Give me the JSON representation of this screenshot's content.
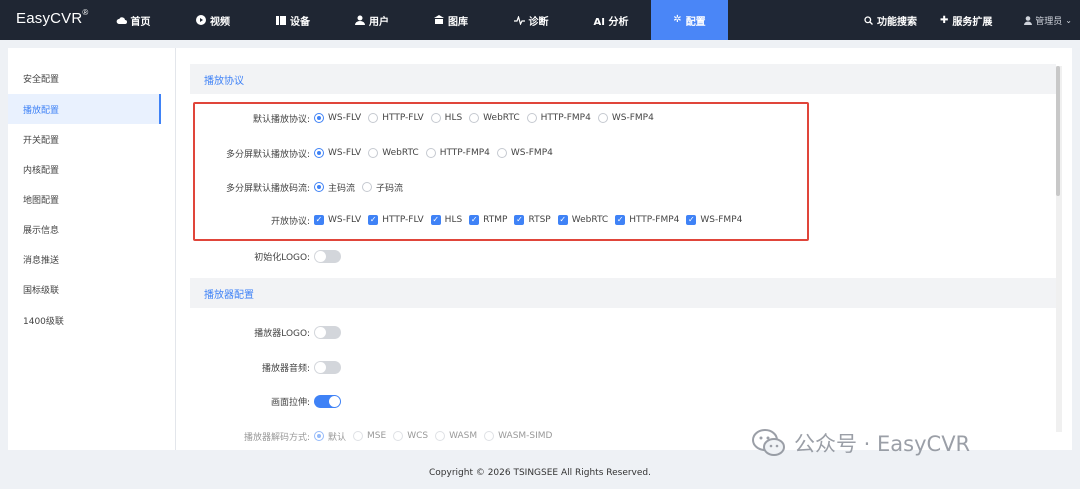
{
  "app": {
    "brand": "EasyCVR",
    "brand_mark": "®"
  },
  "nav": {
    "items": [
      {
        "label": "首页",
        "icon": "cloud-icon"
      },
      {
        "label": "视频",
        "icon": "play-icon"
      },
      {
        "label": "设备",
        "icon": "device-icon"
      },
      {
        "label": "用户",
        "icon": "user-icon"
      },
      {
        "label": "图库",
        "icon": "gallery-icon"
      },
      {
        "label": "诊断",
        "icon": "pulse-icon"
      },
      {
        "label": "AI 分析",
        "icon": ""
      },
      {
        "label": "配置",
        "icon": "gear-icon"
      }
    ],
    "search_label": "功能搜索",
    "extension_label": "服务扩展",
    "user_label": "管理员",
    "accent": "#4a86f7"
  },
  "sidebar": {
    "items": [
      "安全配置",
      "播放配置",
      "开关配置",
      "内核配置",
      "地图配置",
      "展示信息",
      "消息推送",
      "国标级联",
      "1400级联"
    ],
    "active": 1
  },
  "sections": {
    "playback_protocol": "播放协议",
    "player_config": "播放器配置"
  },
  "form": {
    "default_protocol": {
      "label": "默认播放协议:",
      "options": [
        "WS-FLV",
        "HTTP-FLV",
        "HLS",
        "WebRTC",
        "HTTP-FMP4",
        "WS-FMP4"
      ],
      "selected": 0
    },
    "multi_default_protocol": {
      "label": "多分屏默认播放协议:",
      "options": [
        "WS-FLV",
        "WebRTC",
        "HTTP-FMP4",
        "WS-FMP4"
      ],
      "selected": 0
    },
    "multi_default_stream": {
      "label": "多分屏默认播放码流:",
      "options": [
        "主码流",
        "子码流"
      ],
      "selected": 0
    },
    "open_protocols": {
      "label": "开放协议:",
      "options": [
        "WS-FLV",
        "HTTP-FLV",
        "HLS",
        "RTMP",
        "RTSP",
        "WebRTC",
        "HTTP-FMP4",
        "WS-FMP4"
      ],
      "checked": [
        true,
        true,
        true,
        true,
        true,
        true,
        true,
        true
      ]
    },
    "init_logo": {
      "label": "初始化LOGO:",
      "on": false
    },
    "player_logo": {
      "label": "播放器LOGO:",
      "on": false
    },
    "player_audio": {
      "label": "播放器音频:",
      "on": false
    },
    "stretch": {
      "label": "画面拉伸:",
      "on": true
    },
    "decode": {
      "label": "播放器解码方式:",
      "options": [
        "默认",
        "MSE",
        "WCS",
        "WASM",
        "WASM-SIMD"
      ],
      "selected": 0
    }
  },
  "footer": {
    "copyright": "Copyright © 2026 TSINGSEE All Rights Reserved."
  },
  "watermark": {
    "text": "公众号 · EasyCVR"
  }
}
